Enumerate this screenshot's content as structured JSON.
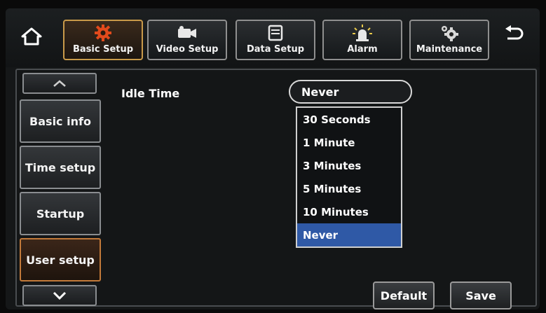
{
  "toolbar": {
    "home_icon": "home-icon",
    "back_icon": "back-arrow-icon",
    "tabs": [
      {
        "label": "Basic Setup",
        "icon": "gear-icon",
        "active": true
      },
      {
        "label": "Video Setup",
        "icon": "camera-icon",
        "active": false
      },
      {
        "label": "Data Setup",
        "icon": "storage-icon",
        "active": false
      },
      {
        "label": "Alarm",
        "icon": "alarm-light-icon",
        "active": false
      },
      {
        "label": "Maintenance",
        "icon": "gears-icon",
        "active": false
      }
    ]
  },
  "sidebar": {
    "up_icon": "chevron-up-icon",
    "down_icon": "chevron-down-icon",
    "items": [
      {
        "label": "Basic info"
      },
      {
        "label": "Time setup"
      },
      {
        "label": "Startup"
      },
      {
        "label": "User setup"
      }
    ]
  },
  "content": {
    "idle_time_label": "Idle Time",
    "idle_time_value": "Never",
    "options": [
      "30 Seconds",
      "1 Minute",
      "3 Minutes",
      "5 Minutes",
      "10 Minutes",
      "Never"
    ]
  },
  "buttons": {
    "default_label": "Default",
    "save_label": "Save"
  },
  "colors": {
    "accent_active": "#c99a4a",
    "selection": "#2f59a6"
  }
}
